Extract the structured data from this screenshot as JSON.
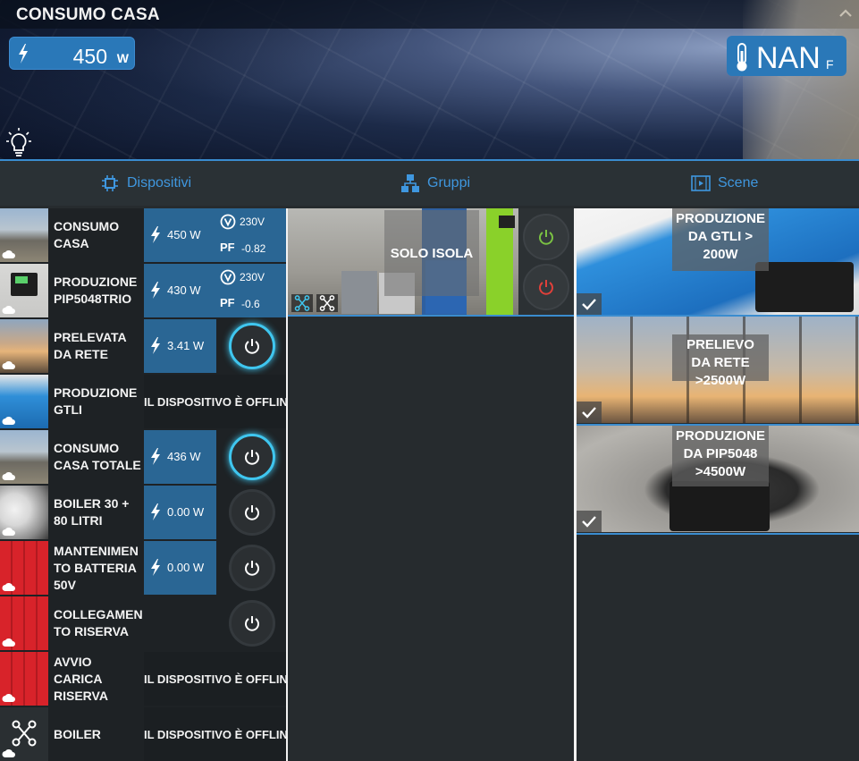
{
  "app": {
    "title": "CONSUMO CASA"
  },
  "header": {
    "power_value": "450",
    "power_unit": "W",
    "temperature_value": "NAN",
    "temperature_unit": "F"
  },
  "tabs": [
    {
      "label": "Dispositivi",
      "icon": "chip-icon"
    },
    {
      "label": "Gruppi",
      "icon": "network-icon"
    },
    {
      "label": "Scene",
      "icon": "film-icon"
    }
  ],
  "devices": [
    {
      "name": "CONSUMO CASA",
      "power": "450 W",
      "voltage": "230V",
      "pf_label": "PF",
      "pf": "-0.82",
      "kind": "meter"
    },
    {
      "name": "PRODUZIONE PIP5048TRIO",
      "power": "430 W",
      "voltage": "230V",
      "pf_label": "PF",
      "pf": "-0.6",
      "kind": "meter"
    },
    {
      "name": "PRELEVATA DA RETE",
      "power": "3.41 W",
      "kind": "switch",
      "state": "on"
    },
    {
      "name": "PRODUZIONE GTLI",
      "offline": "IL DISPOSITIVO È OFFLINE",
      "kind": "offline"
    },
    {
      "name": "CONSUMO CASA TOTALE",
      "power": "436 W",
      "kind": "switch",
      "state": "on"
    },
    {
      "name": "BOILER 30 + 80 LITRI",
      "power": "0.00 W",
      "kind": "switch",
      "state": "off"
    },
    {
      "name": "MANTENIMEN TO BATTERIA 50V",
      "power": "0.00 W",
      "kind": "switch",
      "state": "off"
    },
    {
      "name": "COLLEGAMEN TO RISERVA",
      "kind": "switch-nopower",
      "state": "off"
    },
    {
      "name": "AVVIO CARICA RISERVA",
      "offline": "IL DISPOSITIVO È OFFLINE",
      "kind": "offline"
    },
    {
      "name": "BOILER",
      "offline": "IL DISPOSITIVO È OFFLINE",
      "kind": "offline"
    }
  ],
  "groups": [
    {
      "name": "SOLO ISOLA"
    }
  ],
  "scenes": [
    {
      "name": "PRODUZIONE DA GTLI > 200W"
    },
    {
      "name": "PRELIEVO DA RETE >2500W"
    },
    {
      "name": "PRODUZIONE DA PIP5048 >4500W"
    }
  ],
  "colors": {
    "accent": "#3a8ccf",
    "power_cell": "#2a6694",
    "on_ring": "#3fc6ef",
    "green": "#7ac143",
    "red": "#e0403a"
  }
}
